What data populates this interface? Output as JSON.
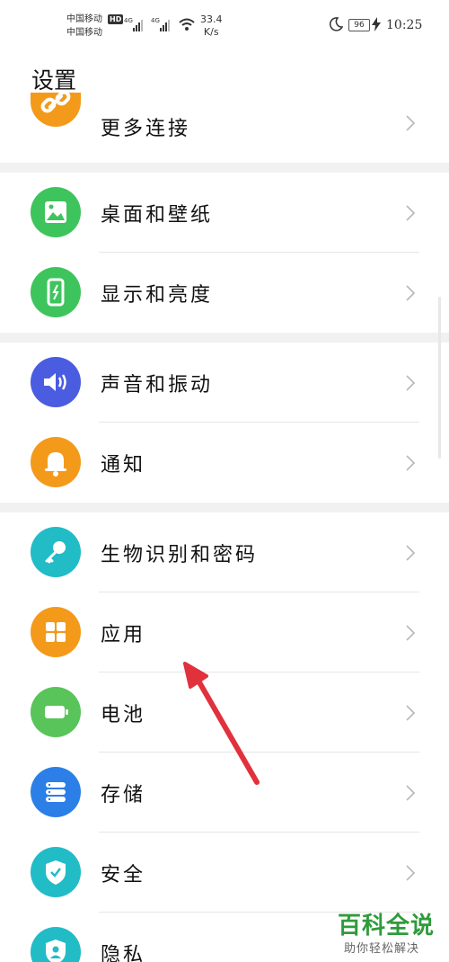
{
  "status_bar": {
    "carrier_1": "中国移动",
    "carrier_2": "中国移动",
    "hd": "HD",
    "network_1": "4G",
    "network_2": "4G",
    "speed_value": "33.4",
    "speed_unit": "K/s",
    "battery": "96",
    "time": "10:25"
  },
  "page": {
    "title": "设置"
  },
  "items": [
    {
      "label": "更多连接",
      "icon": "link-icon",
      "color": "#f39a1b"
    },
    {
      "label": "桌面和壁纸",
      "icon": "image-icon",
      "color": "#3ec45c"
    },
    {
      "label": "显示和亮度",
      "icon": "phone-brightness-icon",
      "color": "#3ec45c"
    },
    {
      "label": "声音和振动",
      "icon": "speaker-icon",
      "color": "#4a5ce0"
    },
    {
      "label": "通知",
      "icon": "bell-icon",
      "color": "#f39a1b"
    },
    {
      "label": "生物识别和密码",
      "icon": "key-icon",
      "color": "#21bcc6"
    },
    {
      "label": "应用",
      "icon": "apps-grid-icon",
      "color": "#f39a1b"
    },
    {
      "label": "电池",
      "icon": "battery-icon",
      "color": "#58c45a"
    },
    {
      "label": "存储",
      "icon": "storage-icon",
      "color": "#2b7fe6"
    },
    {
      "label": "安全",
      "icon": "shield-icon",
      "color": "#21bcc6"
    },
    {
      "label": "隐私",
      "icon": "privacy-icon",
      "color": "#21bcc6"
    }
  ],
  "watermark": {
    "title": "百科全说",
    "subtitle": "助你轻松解决"
  }
}
